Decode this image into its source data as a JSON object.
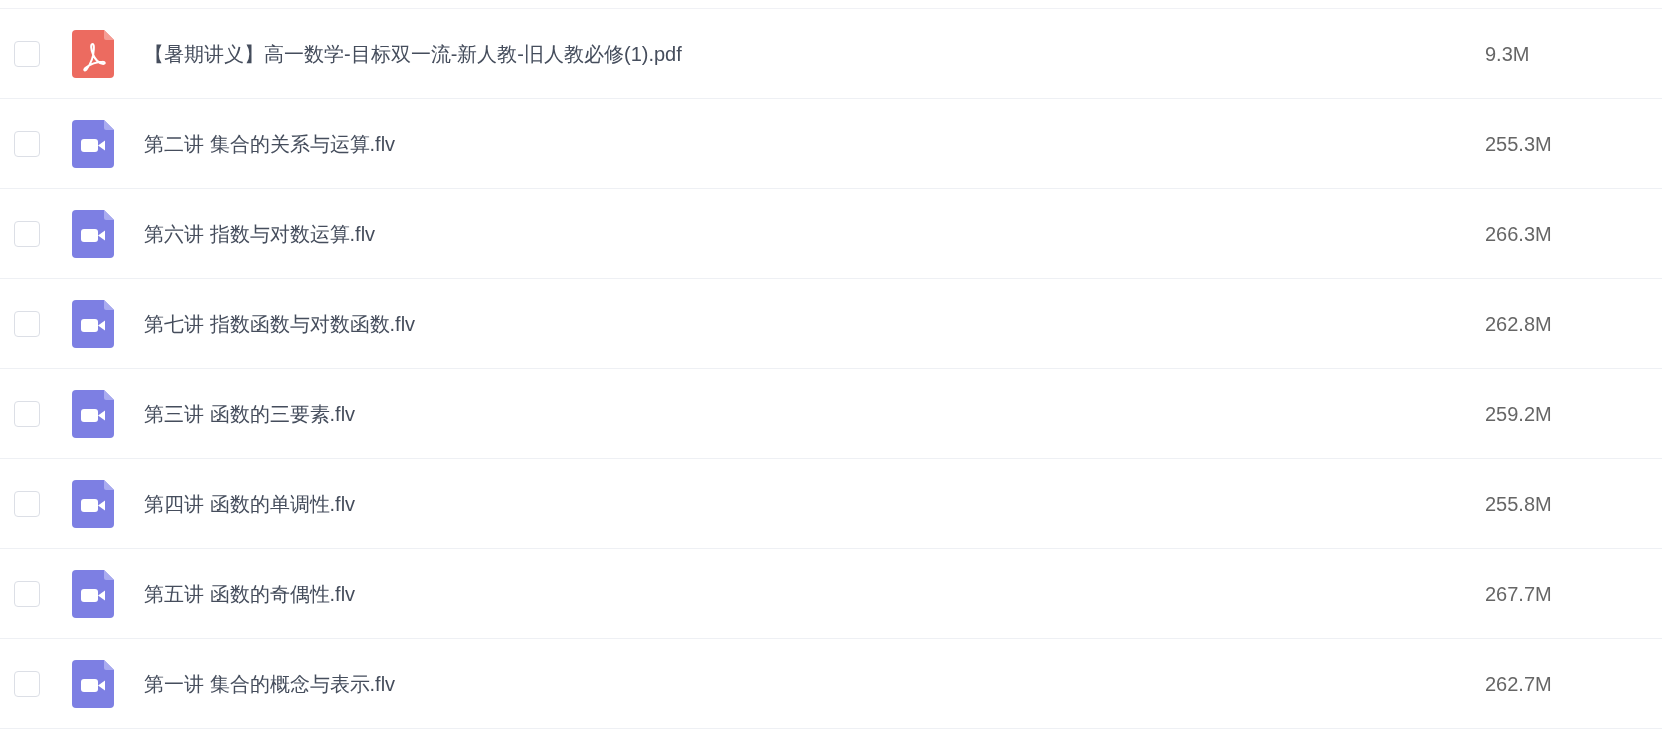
{
  "files": [
    {
      "kind": "pdf",
      "checked": false,
      "name": "【暑期讲义】高一数学-目标双一流-新人教-旧人教必修(1).pdf",
      "size": "9.3M"
    },
    {
      "kind": "video",
      "checked": false,
      "name": "第二讲 集合的关系与运算.flv",
      "size": "255.3M"
    },
    {
      "kind": "video",
      "checked": false,
      "name": "第六讲 指数与对数运算.flv",
      "size": "266.3M"
    },
    {
      "kind": "video",
      "checked": false,
      "name": "第七讲 指数函数与对数函数.flv",
      "size": "262.8M"
    },
    {
      "kind": "video",
      "checked": false,
      "name": "第三讲 函数的三要素.flv",
      "size": "259.2M"
    },
    {
      "kind": "video",
      "checked": false,
      "name": "第四讲 函数的单调性.flv",
      "size": "255.8M"
    },
    {
      "kind": "video",
      "checked": false,
      "name": "第五讲 函数的奇偶性.flv",
      "size": "267.7M"
    },
    {
      "kind": "video",
      "checked": false,
      "name": "第一讲 集合的概念与表示.flv",
      "size": "262.7M"
    }
  ]
}
